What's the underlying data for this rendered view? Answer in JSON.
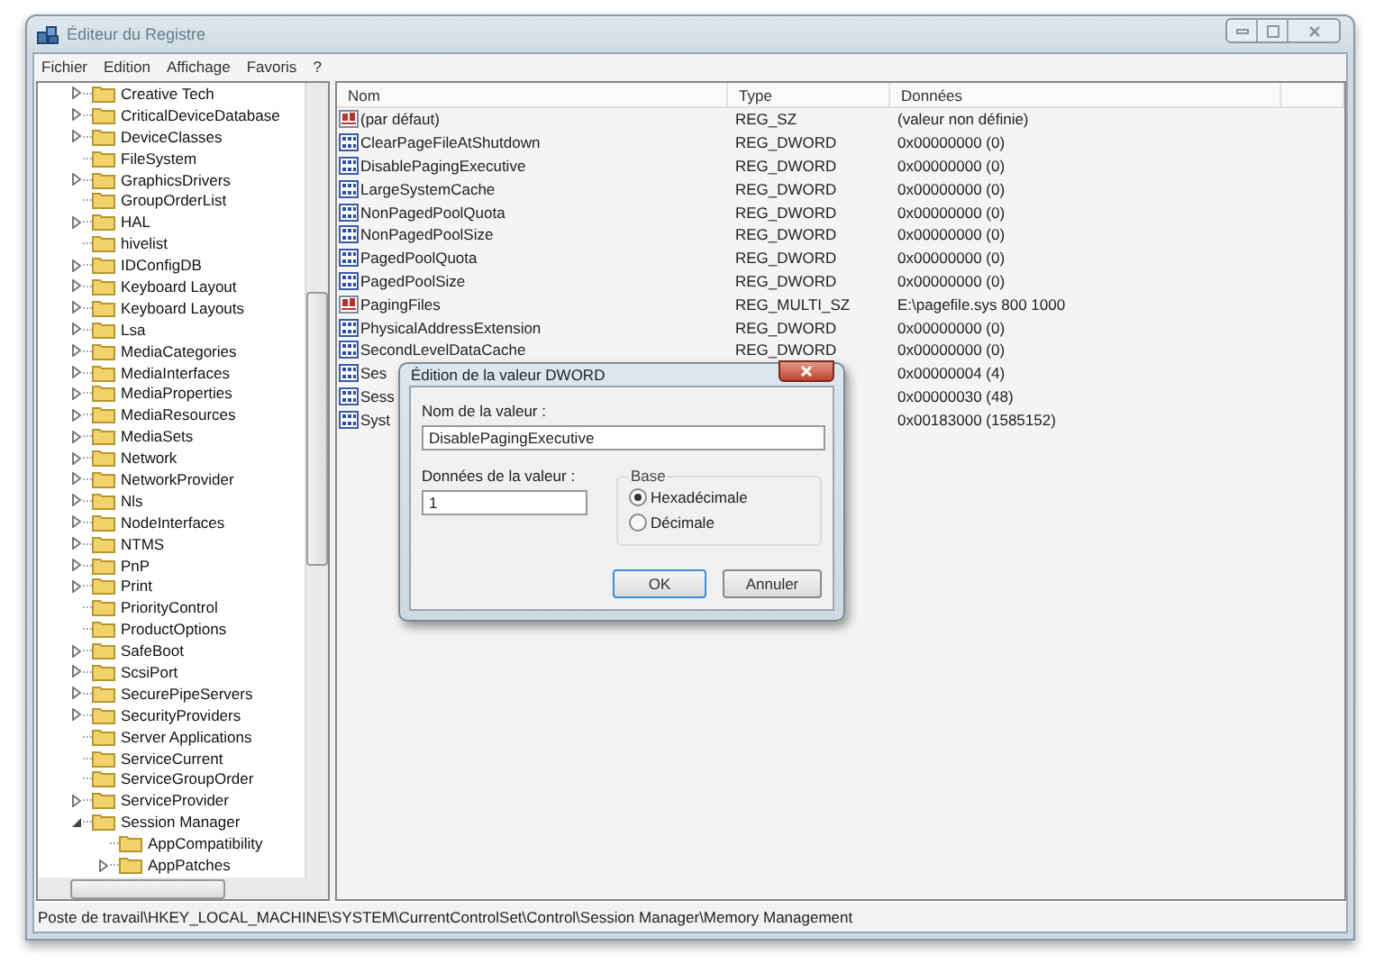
{
  "window": {
    "title": "Éditeur du Registre"
  },
  "menu": [
    "Fichier",
    "Edition",
    "Affichage",
    "Favoris",
    "?"
  ],
  "tree": [
    {
      "label": "Creative Tech",
      "expanded": false
    },
    {
      "label": "CriticalDeviceDatabase",
      "expanded": false
    },
    {
      "label": "DeviceClasses",
      "expanded": false
    },
    {
      "label": "FileSystem"
    },
    {
      "label": "GraphicsDrivers",
      "expanded": false
    },
    {
      "label": "GroupOrderList"
    },
    {
      "label": "HAL",
      "expanded": false
    },
    {
      "label": "hivelist"
    },
    {
      "label": "IDConfigDB",
      "expanded": false
    },
    {
      "label": "Keyboard Layout",
      "expanded": false
    },
    {
      "label": "Keyboard Layouts",
      "expanded": false
    },
    {
      "label": "Lsa",
      "expanded": false
    },
    {
      "label": "MediaCategories",
      "expanded": false
    },
    {
      "label": "MediaInterfaces",
      "expanded": false
    },
    {
      "label": "MediaProperties",
      "expanded": false
    },
    {
      "label": "MediaResources",
      "expanded": false
    },
    {
      "label": "MediaSets",
      "expanded": false
    },
    {
      "label": "Network",
      "expanded": false
    },
    {
      "label": "NetworkProvider",
      "expanded": false
    },
    {
      "label": "Nls",
      "expanded": false
    },
    {
      "label": "NodeInterfaces",
      "expanded": false
    },
    {
      "label": "NTMS",
      "expanded": false
    },
    {
      "label": "PnP",
      "expanded": false
    },
    {
      "label": "Print",
      "expanded": false
    },
    {
      "label": "PriorityControl"
    },
    {
      "label": "ProductOptions"
    },
    {
      "label": "SafeBoot",
      "expanded": false
    },
    {
      "label": "ScsiPort",
      "expanded": false
    },
    {
      "label": "SecurePipeServers",
      "expanded": false
    },
    {
      "label": "SecurityProviders",
      "expanded": false
    },
    {
      "label": "Server Applications"
    },
    {
      "label": "ServiceCurrent"
    },
    {
      "label": "ServiceGroupOrder"
    },
    {
      "label": "ServiceProvider",
      "expanded": false
    },
    {
      "label": "Session Manager",
      "expanded": true,
      "children": [
        {
          "label": "AppCompatibility"
        },
        {
          "label": "AppPatches",
          "expanded": false
        }
      ]
    }
  ],
  "values": {
    "columns": [
      "Nom",
      "Type",
      "Données"
    ],
    "rows": [
      {
        "kind": "string",
        "name": "(par défaut)",
        "type": "REG_SZ",
        "data": "(valeur non définie)"
      },
      {
        "kind": "dword",
        "name": "ClearPageFileAtShutdown",
        "type": "REG_DWORD",
        "data": "0x00000000 (0)"
      },
      {
        "kind": "dword",
        "name": "DisablePagingExecutive",
        "type": "REG_DWORD",
        "data": "0x00000000 (0)"
      },
      {
        "kind": "dword",
        "name": "LargeSystemCache",
        "type": "REG_DWORD",
        "data": "0x00000000 (0)"
      },
      {
        "kind": "dword",
        "name": "NonPagedPoolQuota",
        "type": "REG_DWORD",
        "data": "0x00000000 (0)"
      },
      {
        "kind": "dword",
        "name": "NonPagedPoolSize",
        "type": "REG_DWORD",
        "data": "0x00000000 (0)"
      },
      {
        "kind": "dword",
        "name": "PagedPoolQuota",
        "type": "REG_DWORD",
        "data": "0x00000000 (0)"
      },
      {
        "kind": "dword",
        "name": "PagedPoolSize",
        "type": "REG_DWORD",
        "data": "0x00000000 (0)"
      },
      {
        "kind": "string",
        "name": "PagingFiles",
        "type": "REG_MULTI_SZ",
        "data": "E:\\pagefile.sys 800 1000"
      },
      {
        "kind": "dword",
        "name": "PhysicalAddressExtension",
        "type": "REG_DWORD",
        "data": "0x00000000 (0)"
      },
      {
        "kind": "dword",
        "name": "SecondLevelDataCache",
        "type": "REG_DWORD",
        "data": "0x00000000 (0)"
      },
      {
        "kind": "dword",
        "name": "Ses",
        "data": "0x00000004 (4)"
      },
      {
        "kind": "dword",
        "name": "Sess",
        "data": "0x00000030 (48)"
      },
      {
        "kind": "dword",
        "name": "Syst",
        "data": "0x00183000 (1585152)"
      }
    ]
  },
  "dialog": {
    "title": "Édition de la valeur DWORD",
    "name_label": "Nom de la valeur :",
    "name_value": "DisablePagingExecutive",
    "data_label": "Données de la valeur :",
    "data_value": "1",
    "base_label": "Base",
    "radios": [
      {
        "label": "Hexadécimale",
        "selected": true
      },
      {
        "label": "Décimale",
        "selected": false
      }
    ],
    "buttons": [
      "OK",
      "Annuler"
    ]
  },
  "status_bar": "Poste de travail\\HKEY_LOCAL_MACHINE\\SYSTEM\\CurrentControlSet\\Control\\Session Manager\\Memory Management"
}
